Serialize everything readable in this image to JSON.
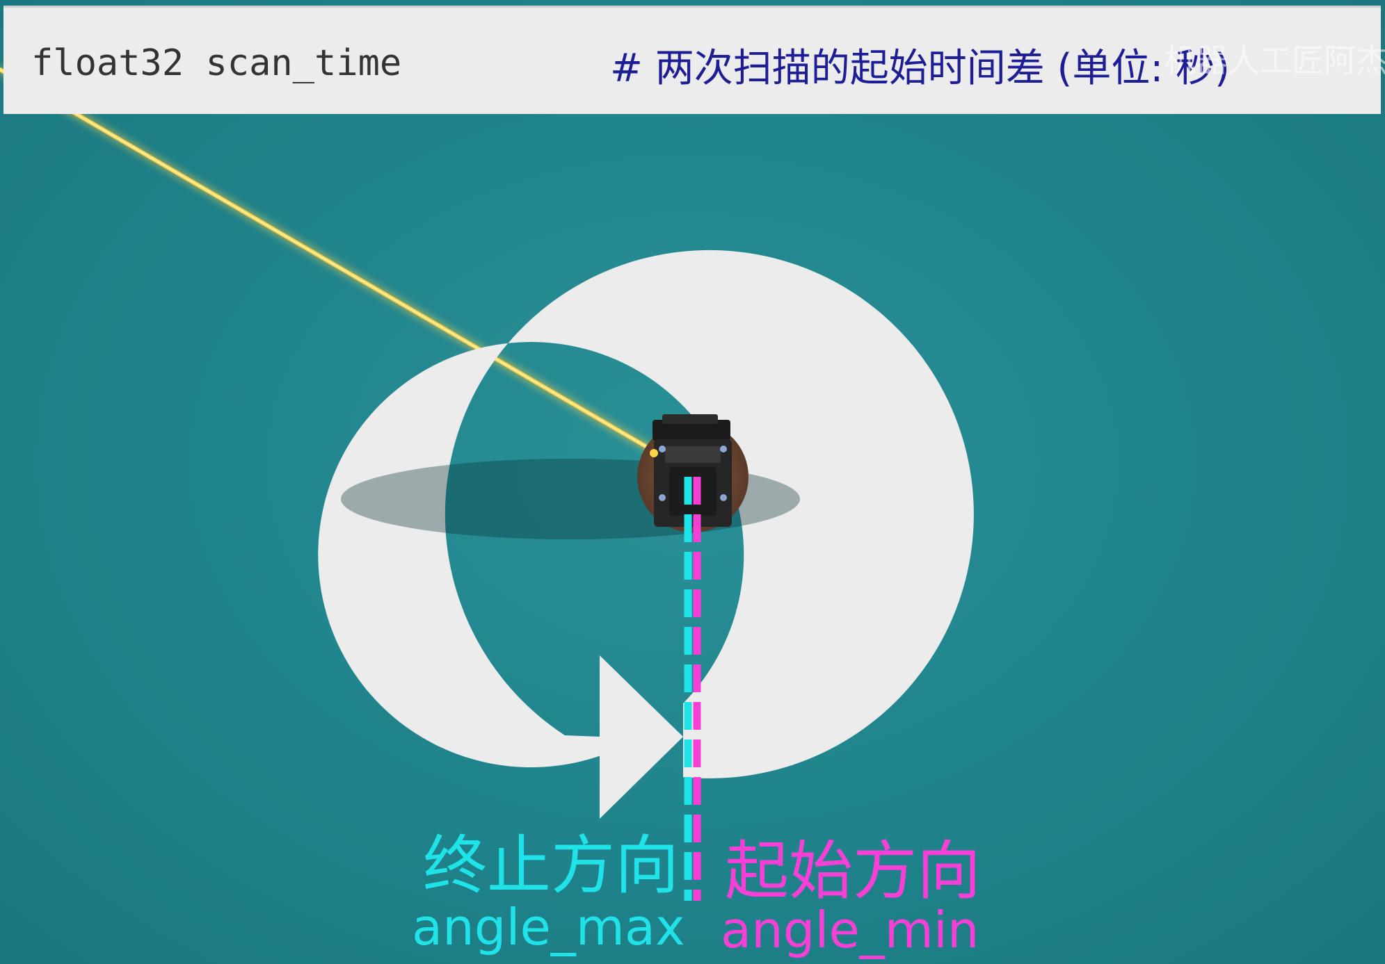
{
  "code_bar": {
    "code": "float32 scan_time",
    "comment": "# 两次扫描的起始时间差 (单位: 秒)",
    "watermark": "机器人工匠阿杰"
  },
  "labels": {
    "end_direction": "终止方向",
    "angle_max": "angle_max",
    "start_direction": "起始方向",
    "angle_min": "angle_min"
  },
  "colors": {
    "background": "#21858d",
    "code_bar": "#ececec",
    "comment": "#1d1d96",
    "angle_max": "#1fe3e8",
    "angle_min": "#f53fd6",
    "arrow": "#ececec",
    "laser_beam": "#ffd24a"
  },
  "icons": {
    "robot": "robot-top-view-icon",
    "rotation_arrow": "clockwise-arrow-icon"
  }
}
